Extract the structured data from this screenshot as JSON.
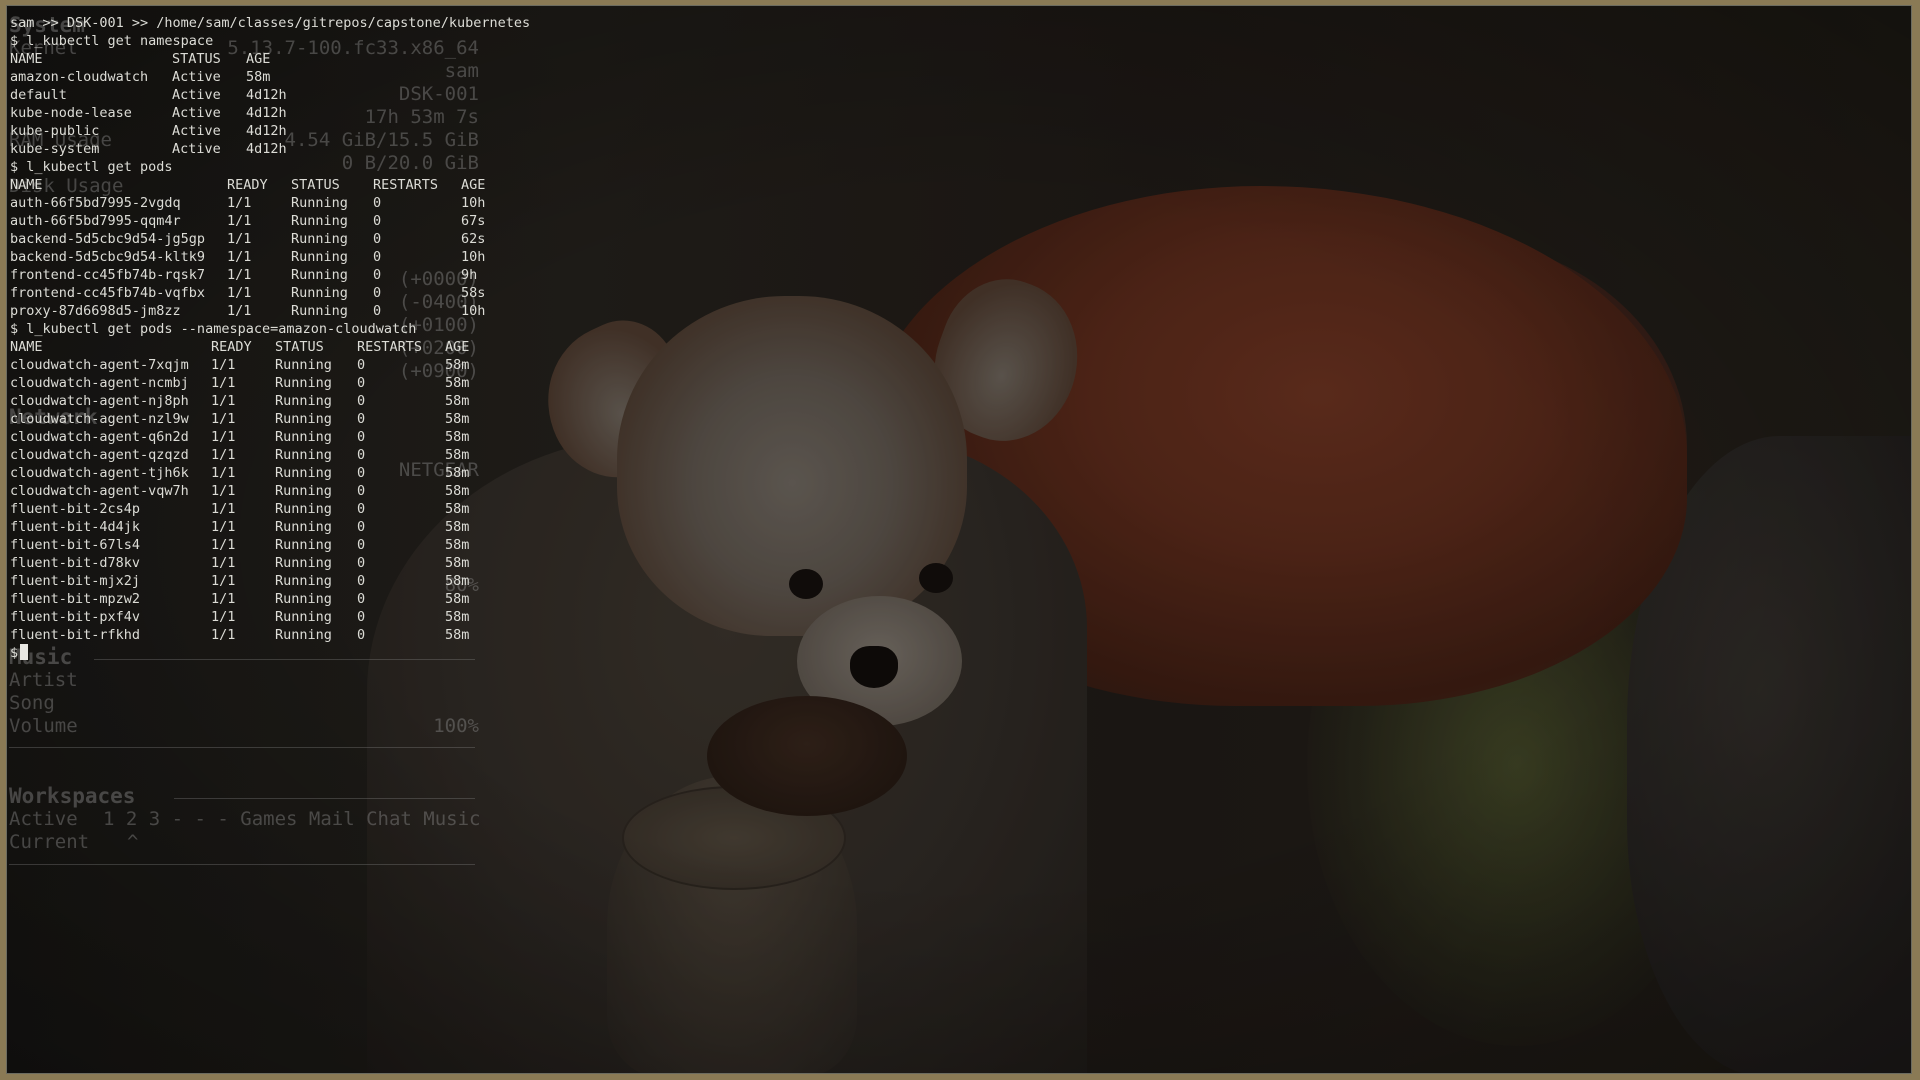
{
  "prompt_header": "sam >> DSK-001 >> /home/sam/classes/gitrepos/capstone/kubernetes",
  "commands": {
    "get_namespace": "$ l_kubectl get namespace",
    "get_pods": "$ l_kubectl get pods",
    "get_pods_cloudwatch": "$ l_kubectl get pods --namespace=amazon-cloudwatch",
    "prompt": "$"
  },
  "namespace_table": {
    "headers": [
      "NAME",
      "STATUS",
      "AGE"
    ],
    "rows": [
      [
        "amazon-cloudwatch",
        "Active",
        "58m"
      ],
      [
        "default",
        "Active",
        "4d12h"
      ],
      [
        "kube-node-lease",
        "Active",
        "4d12h"
      ],
      [
        "kube-public",
        "Active",
        "4d12h"
      ],
      [
        "kube-system",
        "Active",
        "4d12h"
      ]
    ]
  },
  "pods_table": {
    "headers": [
      "NAME",
      "READY",
      "STATUS",
      "RESTARTS",
      "AGE"
    ],
    "rows": [
      [
        "auth-66f5bd7995-2vgdq",
        "1/1",
        "Running",
        "0",
        "10h"
      ],
      [
        "auth-66f5bd7995-qqm4r",
        "1/1",
        "Running",
        "0",
        "67s"
      ],
      [
        "backend-5d5cbc9d54-jg5gp",
        "1/1",
        "Running",
        "0",
        "62s"
      ],
      [
        "backend-5d5cbc9d54-kltk9",
        "1/1",
        "Running",
        "0",
        "10h"
      ],
      [
        "frontend-cc45fb74b-rqsk7",
        "1/1",
        "Running",
        "0",
        "9h"
      ],
      [
        "frontend-cc45fb74b-vqfbx",
        "1/1",
        "Running",
        "0",
        "58s"
      ],
      [
        "proxy-87d6698d5-jm8zz",
        "1/1",
        "Running",
        "0",
        "10h"
      ]
    ]
  },
  "cloudwatch_table": {
    "headers": [
      "NAME",
      "READY",
      "STATUS",
      "RESTARTS",
      "AGE"
    ],
    "rows": [
      [
        "cloudwatch-agent-7xqjm",
        "1/1",
        "Running",
        "0",
        "58m"
      ],
      [
        "cloudwatch-agent-ncmbj",
        "1/1",
        "Running",
        "0",
        "58m"
      ],
      [
        "cloudwatch-agent-nj8ph",
        "1/1",
        "Running",
        "0",
        "58m"
      ],
      [
        "cloudwatch-agent-nzl9w",
        "1/1",
        "Running",
        "0",
        "58m"
      ],
      [
        "cloudwatch-agent-q6n2d",
        "1/1",
        "Running",
        "0",
        "58m"
      ],
      [
        "cloudwatch-agent-qzqzd",
        "1/1",
        "Running",
        "0",
        "58m"
      ],
      [
        "cloudwatch-agent-tjh6k",
        "1/1",
        "Running",
        "0",
        "58m"
      ],
      [
        "cloudwatch-agent-vqw7h",
        "1/1",
        "Running",
        "0",
        "58m"
      ],
      [
        "fluent-bit-2cs4p",
        "1/1",
        "Running",
        "0",
        "58m"
      ],
      [
        "fluent-bit-4d4jk",
        "1/1",
        "Running",
        "0",
        "58m"
      ],
      [
        "fluent-bit-67ls4",
        "1/1",
        "Running",
        "0",
        "58m"
      ],
      [
        "fluent-bit-d78kv",
        "1/1",
        "Running",
        "0",
        "58m"
      ],
      [
        "fluent-bit-mjx2j",
        "1/1",
        "Running",
        "0",
        "58m"
      ],
      [
        "fluent-bit-mpzw2",
        "1/1",
        "Running",
        "0",
        "58m"
      ],
      [
        "fluent-bit-pxf4v",
        "1/1",
        "Running",
        "0",
        "58m"
      ],
      [
        "fluent-bit-rfkhd",
        "1/1",
        "Running",
        "0",
        "58m"
      ]
    ]
  },
  "conky": {
    "system_title": "System",
    "kernel_label": "Kernel",
    "kernel": "5.13.7-100.fc33.x86_64",
    "user": "sam",
    "hostname": "DSK-001",
    "uptime": "17h 53m 7s",
    "ram_label": "RAM Usage",
    "ram": "4.54 GiB/15.5 GiB",
    "swap": "0 B/20.0 GiB",
    "disk_label": "Disk Usage",
    "time_1": "(+0000)",
    "time_2": "(-0400)",
    "time_3": "(+0100)",
    "time_4": "(+0200)",
    "time_5": "(+0900)",
    "network_label": "Network",
    "ssid": "NETGEAR",
    "signal": "80%",
    "music_title": "Music",
    "artist_label": "Artist",
    "song_label": "Song",
    "volume_label": "Volume",
    "volume": "100%",
    "workspaces_title": "Workspaces",
    "active_label": "Active",
    "active_value": "1 2 3 - - - Games Mail Chat Music",
    "current_label": "Current",
    "current_value": "^"
  }
}
